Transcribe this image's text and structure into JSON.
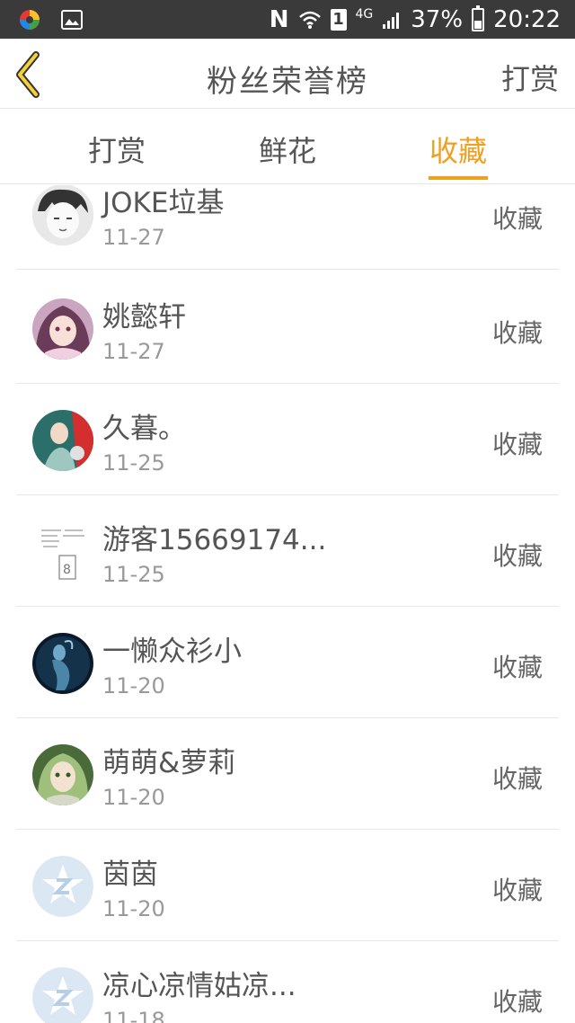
{
  "status_bar": {
    "network": "4G",
    "sim_slot": "1",
    "battery_percent": "37%",
    "battery_level": 0.37,
    "time": "20:22",
    "icons": [
      "app-circle-icon",
      "image-icon",
      "nfc-icon",
      "wifi-icon",
      "sim-icon",
      "signal-icon",
      "battery-icon"
    ]
  },
  "header": {
    "title": "粉丝荣誉榜",
    "action_label": "打赏",
    "back_icon": "chevron-left-icon"
  },
  "tabs": [
    {
      "label": "打赏",
      "active": false
    },
    {
      "label": "鲜花",
      "active": false
    },
    {
      "label": "收藏",
      "active": true
    }
  ],
  "accent_color": "#f0a020",
  "list": [
    {
      "name": "JOKE垃基",
      "date": "11-27",
      "type": "收藏",
      "avatar": "manga-avatar"
    },
    {
      "name": "姚懿轩",
      "date": "11-27",
      "type": "收藏",
      "avatar": "anime-girl-avatar"
    },
    {
      "name": "久暮。",
      "date": "11-25",
      "type": "收藏",
      "avatar": "artwork-avatar"
    },
    {
      "name": "游客15669174...",
      "date": "11-25",
      "type": "收藏",
      "avatar": "document-avatar"
    },
    {
      "name": "一懒众衫小",
      "date": "11-20",
      "type": "收藏",
      "avatar": "blue-figure-avatar"
    },
    {
      "name": "萌萌&萝莉",
      "date": "11-20",
      "type": "收藏",
      "avatar": "elf-avatar"
    },
    {
      "name": "茵茵",
      "date": "11-20",
      "type": "收藏",
      "avatar": "default-star-avatar"
    },
    {
      "name": "凉心凉情姑凉...",
      "date": "11-18",
      "type": "收藏",
      "avatar": "default-star-avatar"
    }
  ]
}
